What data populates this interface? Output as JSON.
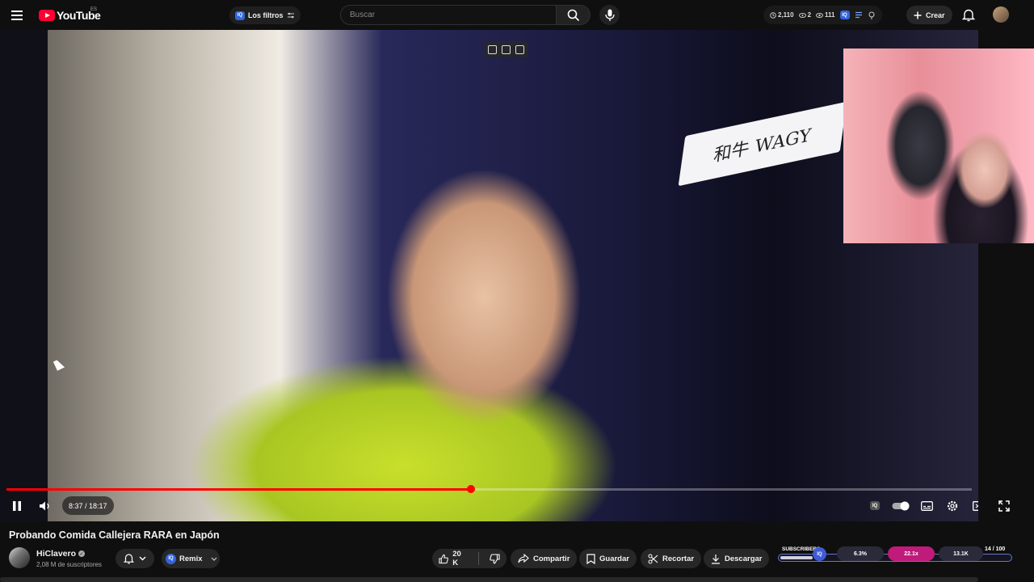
{
  "brand": {
    "name": "YouTube",
    "region": "ES",
    "accent": "#ff0033"
  },
  "topbar": {
    "filters_label": "Los filtros",
    "iq_label": "IQ",
    "search_placeholder": "Buscar",
    "stats": {
      "clock": "2,110",
      "eye_off": "2",
      "eye": "111"
    },
    "create_label": "Crear"
  },
  "player": {
    "sign_text": "和牛 WAGY",
    "progress_fraction": 0.4814,
    "current_time": "8:37",
    "duration": "18:17",
    "time_display": "8:37 / 18:17",
    "iq_label": "IQ"
  },
  "video": {
    "title": "Probando Comida Callejera RARA en Japón",
    "channel": "HiClavero",
    "subscribers": "2,08 M de suscriptores",
    "remix_label": "Remix",
    "likes": "20 K",
    "share_label": "Compartir",
    "save_label": "Guardar",
    "clip_label": "Recortar",
    "download_label": "Descargar"
  },
  "subscriber_widget": {
    "label": "SUBSCRIBERS",
    "iq_label": "IQ",
    "chips": [
      "6.3%",
      "22.1x",
      "13.1K"
    ],
    "chip_colors": [
      "#2a2a3a",
      "#c01a7a",
      "#2a2a3a"
    ],
    "count": "14 / 100",
    "fill_fraction": 0.14
  }
}
